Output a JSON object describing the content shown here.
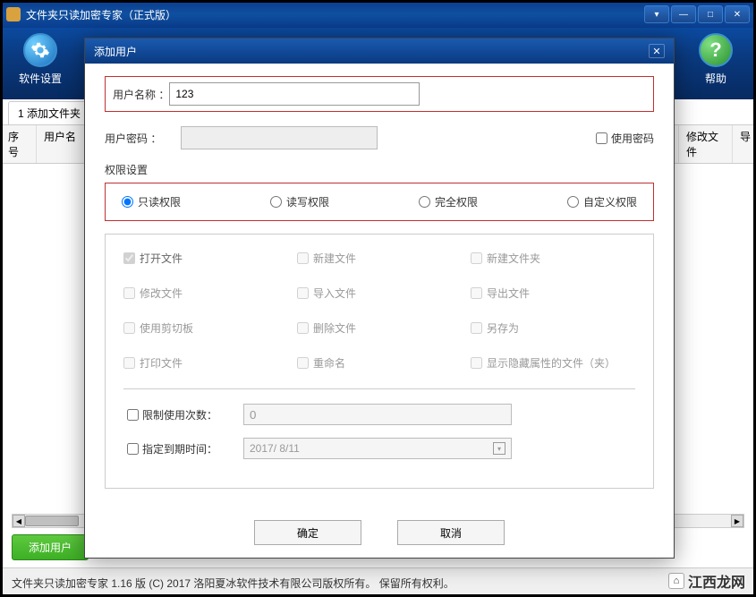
{
  "window": {
    "title": "文件夹只读加密专家（正式版）",
    "win_buttons": {
      "dropdown": "▾",
      "minimize": "—",
      "maximize": "□",
      "close": "✕"
    }
  },
  "ribbon": {
    "settings_label": "软件设置",
    "help_label": "帮助",
    "help_glyph": "?"
  },
  "tabs": {
    "tab1": "1 添加文件夹"
  },
  "table": {
    "col_seq": "序号",
    "col_user": "用户名",
    "col_modify": "修改文件",
    "col_export": "导"
  },
  "scrollbar": {
    "left": "◀",
    "right": "▶"
  },
  "bottom": {
    "add_user_btn": "添加用户"
  },
  "status": "文件夹只读加密专家 1.16 版  (C) 2017 洛阳夏冰软件技术有限公司版权所有。 保留所有权利。",
  "watermark": {
    "icon": "⌂",
    "text": "江西龙网"
  },
  "dialog": {
    "title": "添加用户",
    "close": "✕",
    "username_label": "用户名称 ：",
    "username_value": "123",
    "password_label": "用户密码 ：",
    "password_value": "",
    "use_password": "使用密码",
    "perm_section": "权限设置",
    "radios": {
      "readonly": "只读权限",
      "readwrite": "读写权限",
      "full": "完全权限",
      "custom": "自定义权限"
    },
    "perms": {
      "open": "打开文件",
      "new_file": "新建文件",
      "new_folder": "新建文件夹",
      "modify": "修改文件",
      "import": "导入文件",
      "export": "导出文件",
      "clipboard": "使用剪切板",
      "delete": "删除文件",
      "saveas": "另存为",
      "print": "打印文件",
      "rename": "重命名",
      "show_hidden": "显示隐藏属性的文件（夹）"
    },
    "limit_count_label": "限制使用次数：",
    "limit_count_value": "0",
    "expire_label": "指定到期时间：",
    "expire_value": "2017/ 8/11",
    "date_icon": "▾",
    "ok": "确定",
    "cancel": "取消"
  }
}
